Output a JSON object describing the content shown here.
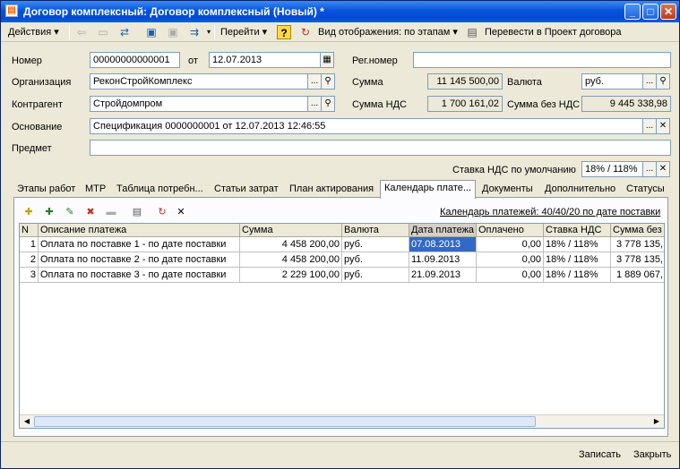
{
  "window": {
    "title": "Договор комплексный: Договор комплексный (Новый) *",
    "min": "_",
    "max": "□",
    "close": "✕"
  },
  "toolbar": {
    "actions": "Действия",
    "goto": "Перейти",
    "help": "?",
    "view_mode": "Вид отображения: по этапам",
    "convert": "Перевести в Проект договора"
  },
  "form": {
    "number_label": "Номер",
    "number": "00000000000001",
    "from_label": "от",
    "date": "12.07.2013",
    "regnum_label": "Рег.номер",
    "regnum": "",
    "org_label": "Организация",
    "org": "РеконСтройКомплекс",
    "sum_label": "Сумма",
    "sum": "11 145 500,00",
    "currency_label": "Валюта",
    "currency": "руб.",
    "contr_label": "Контрагент",
    "contr": "Стройдомпром",
    "vat_sum_label": "Сумма НДС",
    "vat_sum": "1 700 161,02",
    "novat_label": "Сумма без НДС",
    "novat": "9 445 338,98",
    "basis_label": "Основание",
    "basis": "Спецификация 0000000001 от 12.07.2013 12:46:55",
    "subject_label": "Предмет",
    "subject": "",
    "vat_default_label": "Ставка НДС по умолчанию",
    "vat_default": "18% / 118%"
  },
  "tabs": [
    "Этапы работ",
    "МТР",
    "Таблица потребн...",
    "Статьи затрат",
    "План актирования",
    "Календарь плате...",
    "Документы",
    "Дополнительно",
    "Статусы"
  ],
  "payment_calendar_link": "Календарь платежей: 40/40/20 по дате поставки",
  "table": {
    "columns": [
      "N",
      "Описание платежа",
      "Сумма",
      "Валюта",
      "Дата платежа",
      "Оплачено",
      "Ставка НДС",
      "Сумма без ..."
    ],
    "rows": [
      [
        "1",
        "Оплата по поставке 1 - по дате поставки",
        "4 458 200,00",
        "руб.",
        "07.08.2013",
        "0,00",
        "18% / 118%",
        "3 778 135,"
      ],
      [
        "2",
        "Оплата по поставке 2 - по дате поставки",
        "4 458 200,00",
        "руб.",
        "11.09.2013",
        "0,00",
        "18% / 118%",
        "3 778 135,"
      ],
      [
        "3",
        "Оплата по поставке 3 - по дате поставки",
        "2 229 100,00",
        "руб.",
        "21.09.2013",
        "0,00",
        "18% / 118%",
        "1 889 067,"
      ]
    ]
  },
  "footer": {
    "save": "Записать",
    "close": "Закрыть"
  },
  "colors": {
    "title_bar": "#0855dd",
    "selection": "#316ac5",
    "window_bg": "#ece9d8"
  }
}
